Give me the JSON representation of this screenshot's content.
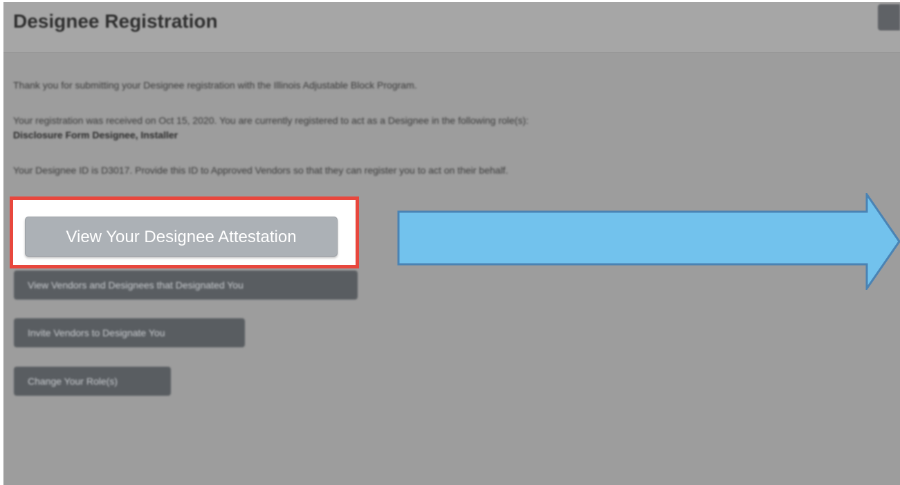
{
  "header": {
    "title": "Designee Registration"
  },
  "content": {
    "thank_you": "Thank you for submitting your Designee registration with the Illinois Adjustable Block Program.",
    "received": "Your registration was received on Oct 15, 2020. You are currently registered to act as a Designee in the following role(s):",
    "roles": "Disclosure Form Designee, Installer",
    "designee_id": "Your Designee ID is D3017. Provide this ID to Approved Vendors so that they can register you to act on their behalf."
  },
  "buttons": {
    "view_attestation": "View Your Designee Attestation",
    "view_vendors": "View Vendors and Designees that Designated You",
    "invite_vendors": "Invite Vendors to Designate You",
    "change_roles": "Change Your Role(s)"
  },
  "colors": {
    "highlight_border": "#e8473d",
    "arrow_fill": "#72c2ed",
    "arrow_stroke": "#4a83b4"
  },
  "icons": {
    "callout_arrow": "right-arrow-icon"
  }
}
